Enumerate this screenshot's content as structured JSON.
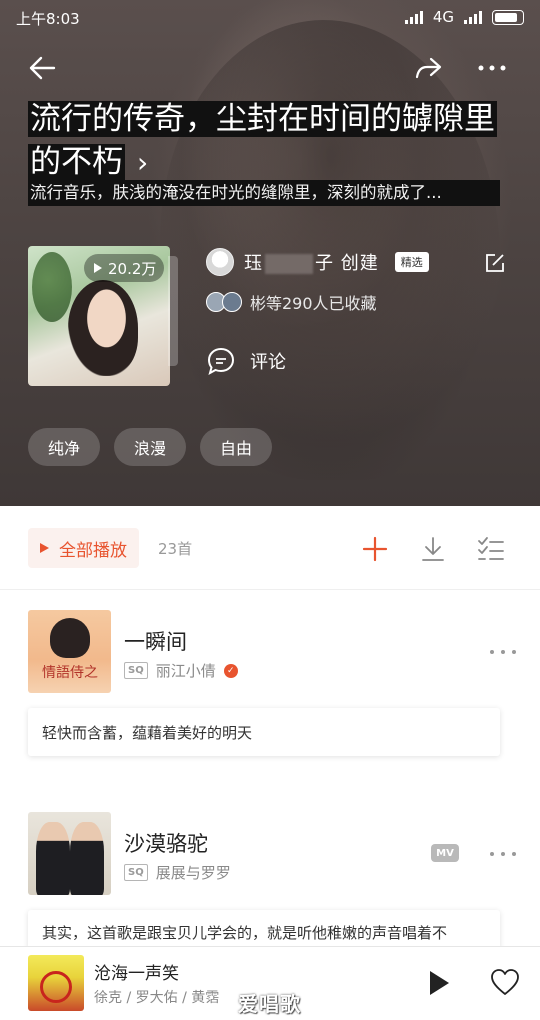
{
  "status_bar": {
    "time": "上午8:03",
    "network": "4G"
  },
  "playlist": {
    "title": "流行的传奇，尘封在时间的罅隙里的不朽",
    "title_chevron": "›",
    "description": "流行音乐，肤浅的淹没在时光的缝隙里，深刻的就成了...",
    "play_count": "20.2万",
    "creator": {
      "name_prefix": "珏",
      "name_suffix": "子 创建",
      "badge": "精选"
    },
    "collect_text": "彬等290人已收藏",
    "comment_label": "评论",
    "tags": [
      "纯净",
      "浪漫",
      "自由"
    ]
  },
  "toolbar": {
    "play_all_label": "全部播放",
    "song_count": "23首"
  },
  "songs": [
    {
      "title": "一瞬间",
      "quality": "SQ",
      "artist": "丽江小倩",
      "cover_text": "情語侍之",
      "note": "轻快而含蓄，蕴藉着美好的明天",
      "has_mv": false
    },
    {
      "title": "沙漠骆驼",
      "quality": "SQ",
      "artist": "展展与罗罗",
      "mv_label": "MV",
      "note": "其实，这首歌是跟宝贝儿学会的，就是听他稚嫩的声音唱着不",
      "has_mv": true
    }
  ],
  "player": {
    "title": "沧海一声笑",
    "artist": "徐克 / 罗大佑 / 黄霑"
  },
  "watermark": "爱唱歌",
  "colors": {
    "accent": "#e8542f",
    "text_secondary": "#8a8a8a"
  }
}
